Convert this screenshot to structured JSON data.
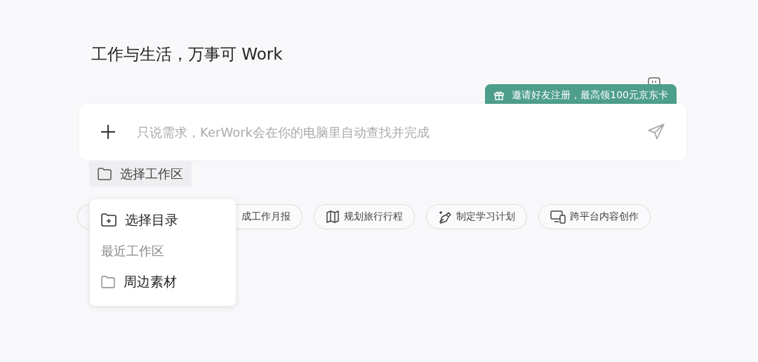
{
  "heading": "工作与生活，万事可 Work",
  "promo": {
    "label": "邀请好友注册，最高领100元京东卡"
  },
  "input": {
    "placeholder": "只说需求，KerWork会在你的电脑里自动查找并完成"
  },
  "workspace_button": {
    "label": "选择工作区"
  },
  "chips": [
    {
      "label": "成工作月报",
      "kind": "cut"
    },
    {
      "label": "规划旅行行程",
      "kind": "map"
    },
    {
      "label": "制定学习计划",
      "kind": "pen"
    },
    {
      "label": "跨平台内容创作",
      "kind": "devices"
    }
  ],
  "menu": {
    "items": [
      {
        "label": "选择目录",
        "kind": "action"
      },
      {
        "label": "最近工作区",
        "kind": "header"
      },
      {
        "label": "周边素材",
        "kind": "folder"
      }
    ]
  }
}
